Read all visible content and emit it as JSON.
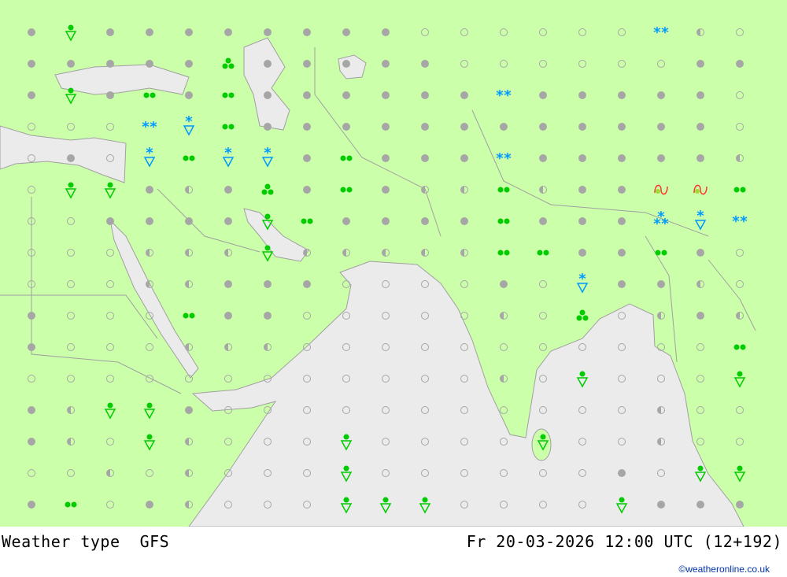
{
  "title": {
    "label": "Weather type",
    "model": "GFS"
  },
  "valid_time": "Fr 20-03-2026 12:00 UTC (12+192)",
  "credit": "©weatheronline.co.uk",
  "colors": {
    "land": "#ccffaa",
    "sea": "#ebebeb",
    "border": "#a0a0a0",
    "symbol_grey": "#a6a6a6",
    "rain": "#00cc00",
    "snow": "#0099ff",
    "freezing": "#ff3333"
  },
  "legend_codes": {
    "F": "overcast",
    "H": "partly cloudy",
    "O": "clear",
    "r": "rain shower",
    "d": "rain",
    "t": "heavy rain",
    "s": "snow",
    "S": "snow shower",
    "3": "heavy snow",
    "f": "freezing rain"
  },
  "grid": [
    "FrFFFFFFFFOOOOOOsHO",
    "FFFFFtFFFFFOOOOOOFF",
    "FrFdFdFFFFFFsFFFFFO",
    "OOOsSdFFFFFFFFFFFFO",
    "OFOSdSSFdFFFsFFFFFH",
    "OrrFHFtFdFHHdHFFffd",
    "OOFFFFrdFFFFdFFF3Ss",
    "OOOHHHrHHHHHddFFdFO",
    "OOOHHFFFOOOOFOSFFHO",
    "FOOOdFFOOOOOHOtOHFH",
    "FOOOHHHOOOOOOOOOOOd",
    "OOOOOOOOOOOOHOrOOOr",
    "FHrrFOOOOOOOOOOOHOO",
    "FHOrHOOOrOOOOrOOHOO",
    "OOHOHOOOrOOOOOOFOrr",
    "FdOFHOOOrrrOOOOrFFF"
  ]
}
